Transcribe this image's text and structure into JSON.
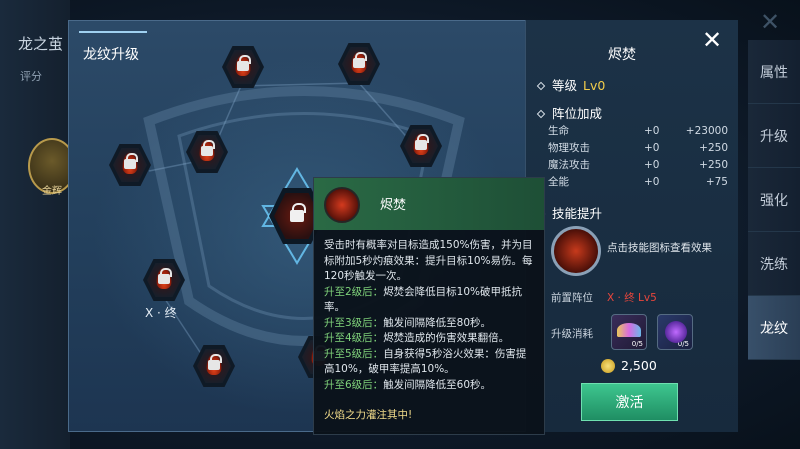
{
  "background": {
    "title": "龙之茧",
    "subtitle": "评分",
    "avatar_label": "金辉"
  },
  "side_tabs": [
    {
      "label": "属性",
      "active": false
    },
    {
      "label": "升级",
      "active": false
    },
    {
      "label": "强化",
      "active": false
    },
    {
      "label": "洗练",
      "active": false
    },
    {
      "label": "龙纹",
      "active": true
    }
  ],
  "panel": {
    "title": "龙纹升级",
    "node_label": "X · 终"
  },
  "tooltip": {
    "name": "烬焚",
    "lines": [
      {
        "text": "受击时有概率对目标造成150%伤害，并为目标附加5秒灼痕效果：提升目标10%易伤。每120秒触发一次。",
        "kind": "desc"
      },
      {
        "text": "升至2级后：",
        "rest": "烬焚会降低目标10%破甲抵抗率。"
      },
      {
        "text": "升至3级后：",
        "rest": "触发间隔降低至80秒。"
      },
      {
        "text": "升至4级后：",
        "rest": "烬焚造成的伤害效果翻倍。"
      },
      {
        "text": "升至5级后：",
        "rest": "自身获得5秒浴火效果：伤害提高10%，破甲率提高10%。"
      },
      {
        "text": "升至6级后：",
        "rest": "触发间隔降低至60秒。"
      }
    ],
    "footer": "火焰之力灌注其中!"
  },
  "info": {
    "name": "烬焚",
    "level_label": "等级",
    "level_value": "Lv0",
    "bonus_title": "阵位加成",
    "stats": [
      {
        "name": "生命",
        "current": "+0",
        "delta": "+23000"
      },
      {
        "name": "物理攻击",
        "current": "+0",
        "delta": "+250"
      },
      {
        "name": "魔法攻击",
        "current": "+0",
        "delta": "+250"
      },
      {
        "name": "全能",
        "current": "+0",
        "delta": "+75"
      }
    ],
    "skill_title": "技能提升",
    "skill_hint": "点击技能图标查看效果",
    "prereq_label": "前置阵位",
    "prereq_value": "X · 终 Lv5",
    "cost_label": "升级消耗",
    "materials": [
      {
        "icon": "rainbow-shard-icon",
        "count": "0/5"
      },
      {
        "icon": "purple-orb-icon",
        "count": "0/5"
      }
    ],
    "gold": "2,500",
    "activate_label": "激活"
  }
}
